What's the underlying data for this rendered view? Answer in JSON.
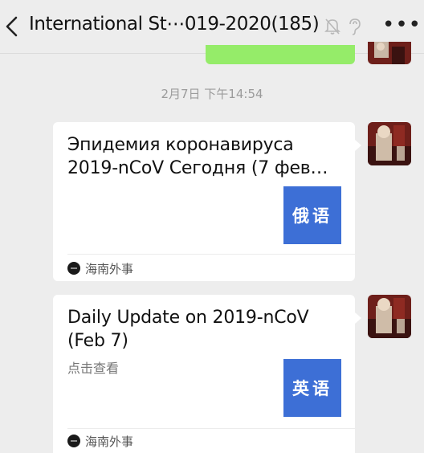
{
  "header": {
    "title": "International St⋯019-2020(185)",
    "icons": [
      "back-icon",
      "mute-icon",
      "ear-icon",
      "more-icon"
    ],
    "more_label": "•••"
  },
  "chat": {
    "timestamp": "2月7日 下午14:54",
    "messages": [
      {
        "title_line1": "Эпидемия коронавируса",
        "title_line2": "2019-nCoV Сегодня (7 фев…",
        "thumb_label": "俄语",
        "source": "海南外事"
      },
      {
        "title_line1": "Daily Update on 2019-nCoV",
        "title_line2": "(Feb 7)",
        "desc": "点击查看",
        "thumb_label": "英语",
        "source": "海南外事"
      }
    ]
  },
  "colors": {
    "background": "#ededed",
    "sent_bubble": "#95ec69",
    "thumb_blue": "#3d6fd6",
    "card": "#ffffff"
  }
}
